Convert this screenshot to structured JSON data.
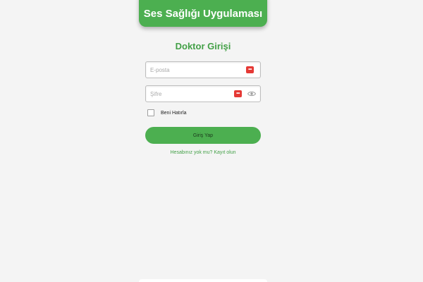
{
  "header": {
    "title": "Ses Sağlığı Uygulaması",
    "color": "#4caf50"
  },
  "form": {
    "title": "Doktor Girişi",
    "email": {
      "placeholder": "E-posta",
      "value": ""
    },
    "password": {
      "placeholder": "Şifre",
      "value": ""
    },
    "password_manager_icon": "password-manager-icon",
    "visibility_icon": "eye-icon",
    "remember_me": {
      "label": "Beni Hatırla",
      "checked": false
    },
    "submit_label": "Giriş Yap",
    "signup_link": "Hesabınız yok mu? Kayıt olun"
  },
  "colors": {
    "accent": "#4caf50",
    "accent_text": "#43a047",
    "background": "#f4f4f4"
  }
}
